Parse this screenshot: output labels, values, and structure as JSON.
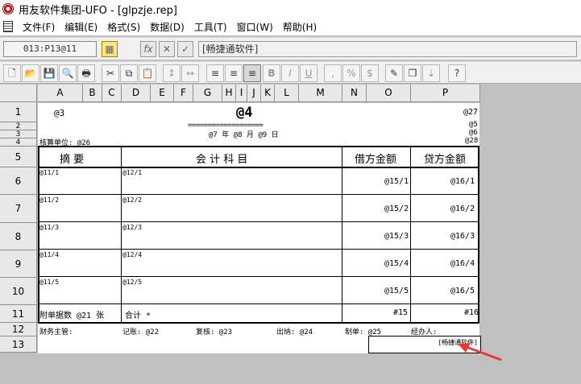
{
  "window": {
    "title": "用友软件集团-UFO - [glpzje.rep]"
  },
  "menu": {
    "items": [
      "文件(F)",
      "编辑(E)",
      "格式(S)",
      "数据(D)",
      "工具(T)",
      "窗口(W)",
      "帮助(H)"
    ]
  },
  "formula_bar": {
    "cell_ref": "013:P13@11",
    "fx_label": "fx",
    "cancel_label": "✕",
    "ok_label": "✓",
    "value": "[畅捷通软件]"
  },
  "columns": [
    "A",
    "B",
    "C",
    "D",
    "E",
    "F",
    "G",
    "H",
    "I",
    "J",
    "K",
    "L",
    "M",
    "N",
    "O",
    "P"
  ],
  "rows": [
    "1",
    "2",
    "3",
    "4",
    "5",
    "6",
    "7",
    "8",
    "9",
    "10",
    "11",
    "12",
    "13"
  ],
  "sheet": {
    "r1_left": "@3",
    "r1_title": "@4",
    "r1_right": "@27",
    "r2_underline": "===================",
    "r2_right": "@5",
    "r3_date": "@7 年 @8 月 @9 日",
    "r3_right": "@6",
    "r4_left": "核算单位: @26",
    "r4_right": "@28",
    "h_summary": "摘    要",
    "h_account": "会  计  科  目",
    "h_debit": "借方金额",
    "h_credit": "贷方金额",
    "lines": [
      {
        "summary": "@11/1",
        "account": "@12/1",
        "debit": "@15/1",
        "credit": "@16/1"
      },
      {
        "summary": "@11/2",
        "account": "@12/2",
        "debit": "@15/2",
        "credit": "@16/2"
      },
      {
        "summary": "@11/3",
        "account": "@12/3",
        "debit": "@15/3",
        "credit": "@16/3"
      },
      {
        "summary": "@11/4",
        "account": "@12/4",
        "debit": "@15/4",
        "credit": "@16/4"
      },
      {
        "summary": "@11/5",
        "account": "@12/5",
        "debit": "@15/5",
        "credit": "@16/5"
      }
    ],
    "r11_attach": "附单据数  @21  张",
    "r11_total": "合计 *",
    "r11_debit": "#15",
    "r11_credit": "#16",
    "r12_finance": "财务主管:",
    "r12_bookkeeper": "记账: @22",
    "r12_review": "复核: @23",
    "r12_cashier": "出纳: @24",
    "r12_preparer": "制单: @25",
    "r12_handler": "经办人:",
    "r13_cell": "[畅捷通软件]"
  }
}
